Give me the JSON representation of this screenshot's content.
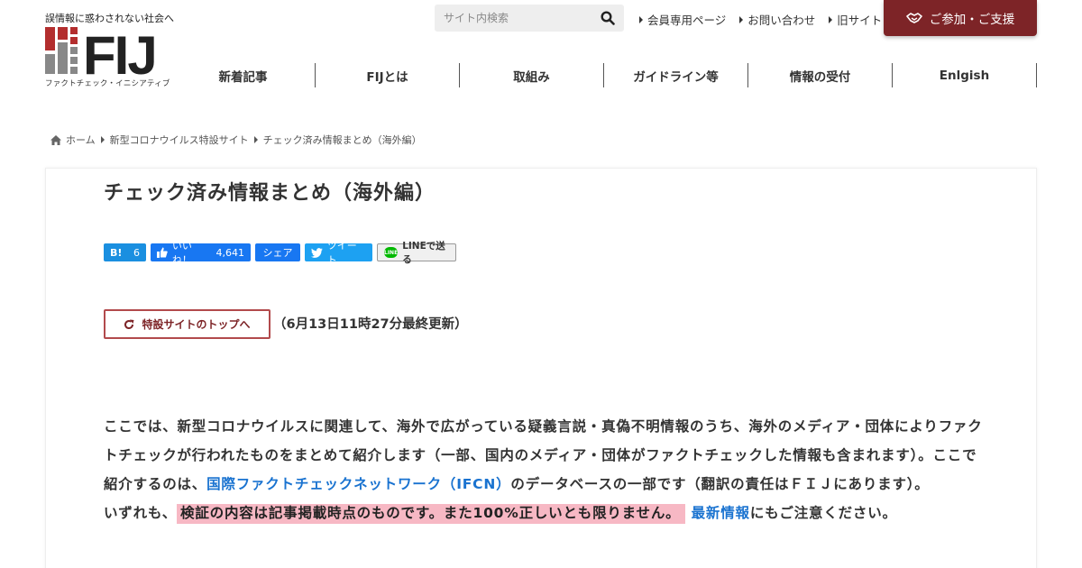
{
  "header": {
    "tagline": "誤情報に惑わされない社会へ",
    "logo_text": "FIJ",
    "logo_subtext": "ファクトチェック・イニシアティブ",
    "search_placeholder": "サイト内検索",
    "top_links": [
      "会員専用ページ",
      "お問い合わせ",
      "旧サイト"
    ],
    "join_button": "ご参加・ご支援",
    "accent_color": "#7d2427"
  },
  "nav": {
    "items": [
      "新着記事",
      "FIJとは",
      "取組み",
      "ガイドライン等",
      "情報の受付",
      "Enlgish"
    ]
  },
  "breadcrumb": {
    "items": [
      "ホーム",
      "新型コロナウイルス特設サイト",
      "チェック済み情報まとめ（海外編）"
    ]
  },
  "article": {
    "title": "チェック済み情報まとめ（海外編）",
    "share": {
      "hatena_label": "B!",
      "hatena_count": "6",
      "like_label": "いいね！",
      "like_count": "4,641",
      "share_label": "シェア",
      "tweet_label": "ツイート",
      "line_label": "LINEで送る",
      "line_badge": "LINE"
    },
    "top_button": "特設サイトのトップへ",
    "updated": "（6月13日11時27分最終更新）",
    "paragraph": {
      "part1": "ここでは、新型コロナウイルスに関連して、海外で広がっている疑義言説・真偽不明情報のうち、海外のメディア・団体によりファクトチェックが行われたものをまとめて紹介します（一部、国内のメディア・団体がファクトチェックした情報も含まれます）。ここで紹介するのは、",
      "link1": "国際ファクトチェックネットワーク（IFCN）",
      "part2": "のデータベースの一部です（翻訳の責任はＦＩＪにあります）。",
      "part3": "いずれも、",
      "highlight": "検証の内容は記事掲載時点のものです。また100%正しいとも限りません。",
      "link2": "最新情報",
      "part4": "にもご注意ください。"
    }
  }
}
